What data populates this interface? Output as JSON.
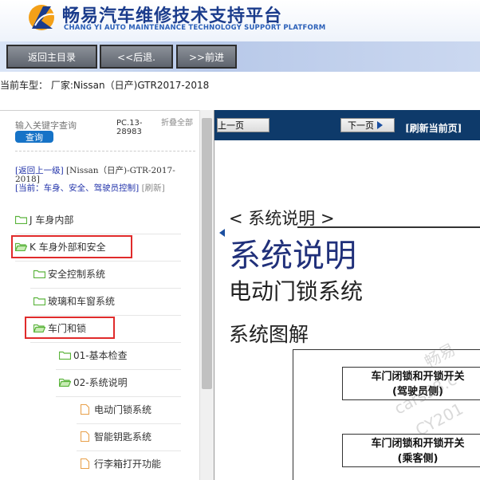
{
  "header": {
    "title": "畅易汽车维修技术支持平台",
    "subtitle": "CHANG YI AUTO MAINTENANCE TECHNOLOGY SUPPORT PLATFORM"
  },
  "toolbar": {
    "home_label": "返回主目录",
    "back_label": "<<后退.",
    "forward_label": ">>前进"
  },
  "current_car": "当前车型：  厂家:Nissan（日产)GTR2017-2018",
  "sidebar": {
    "search_placeholder": "输入关键字查询",
    "search_button": "查询",
    "pc_code": "PC.13-28983",
    "collapse_all": "折叠全部",
    "back_up": "[返回上一级]",
    "model": "[Nissan（日产)-GTR-2017-2018]",
    "current_prefix": "[当前：",
    "current_path": "车身、安全、驾驶员控制]",
    "refresh": "[刷新]",
    "tree": [
      {
        "label": "J 车身内部",
        "type": "folder"
      },
      {
        "label": "K 车身外部和安全",
        "type": "folder",
        "highlighted": true
      },
      {
        "label": "安全控制系统",
        "type": "folder"
      },
      {
        "label": "玻璃和车窗系统",
        "type": "folder"
      },
      {
        "label": "车门和锁",
        "type": "folder",
        "highlighted": true
      },
      {
        "label": "01-基本检查",
        "type": "folder"
      },
      {
        "label": "02-系统说明",
        "type": "folder"
      },
      {
        "label": "电动门锁系统",
        "type": "page"
      },
      {
        "label": "智能钥匙系统",
        "type": "page"
      },
      {
        "label": "行李箱打开功能",
        "type": "page"
      }
    ]
  },
  "document": {
    "prev_label": "上一页",
    "next_label": "下一页",
    "refresh_label": "[刷新当前页]",
    "section_label": "< 系统说明 >",
    "heading": "系统说明",
    "subheading": "电动门锁系统",
    "diagram_title": "系统图解",
    "diagram_box1": [
      "车门闭锁和开锁开关",
      "(驾驶员侧)"
    ],
    "diagram_box2": [
      "车门闭锁和开锁开关",
      "(乘客侧)"
    ],
    "watermark": [
      "畅易",
      "cars58.c",
      "CY201"
    ]
  },
  "colors": {
    "brand_blue": "#1b3c8c",
    "doc_bar": "#0e3a6a",
    "highlight_red": "#e02b2b",
    "folder_green": "#5bb43c",
    "page_orange": "#e8a04a"
  }
}
